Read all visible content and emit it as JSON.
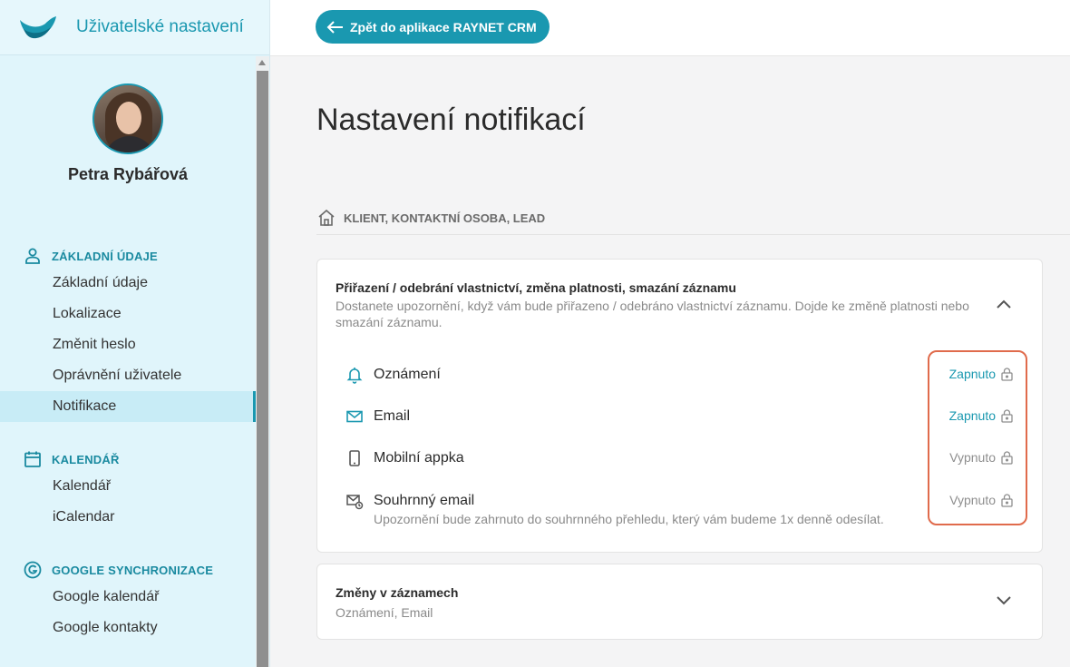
{
  "sidebar": {
    "title": "Uživatelské nastavení",
    "profile_name": "Petra Rybářová",
    "sections": [
      {
        "label": "ZÁKLADNÍ ÚDAJE",
        "icon": "person-icon",
        "items": [
          "Základní údaje",
          "Lokalizace",
          "Změnit heslo",
          "Oprávnění uživatele",
          "Notifikace"
        ]
      },
      {
        "label": "KALENDÁŘ",
        "icon": "calendar-icon",
        "items": [
          "Kalendář",
          "iCalendar"
        ]
      },
      {
        "label": "GOOGLE SYNCHRONIZACE",
        "icon": "google-icon",
        "items": [
          "Google kalendář",
          "Google kontakty"
        ]
      }
    ],
    "active_item": "Notifikace"
  },
  "topbar": {
    "back_label": "Zpět do aplikace RAYNET CRM"
  },
  "main": {
    "title": "Nastavení notifikací",
    "category": "KLIENT, KONTAKTNÍ OSOBA, LEAD",
    "cards": [
      {
        "title": "Přiřazení / odebrání vlastnictví, změna platnosti, smazání záznamu",
        "description": "Dostanete upozornění, když vám bude přiřazeno / odebráno vlastnictví záznamu. Dojde ke změně platnosti nebo smazání záznamu.",
        "expanded": true,
        "rows": [
          {
            "label": "Oznámení",
            "icon": "bell-icon",
            "status": "Zapnuto",
            "enabled": true
          },
          {
            "label": "Email",
            "icon": "mail-icon",
            "status": "Zapnuto",
            "enabled": true
          },
          {
            "label": "Mobilní appka",
            "icon": "phone-icon",
            "status": "Vypnuto",
            "enabled": false
          },
          {
            "label": "Souhrnný email",
            "icon": "mail-clock-icon",
            "status": "Vypnuto",
            "enabled": false,
            "sub": "Upozornění bude zahrnuto do souhrnného přehledu, který vám budeme 1x denně odesílat."
          }
        ]
      },
      {
        "title": "Změny v záznamech",
        "description": "Oznámení, Email",
        "expanded": false
      }
    ]
  },
  "colors": {
    "accent": "#1a98b0",
    "highlight": "#e06b4c",
    "sidebar_bg": "#e0f5fb"
  }
}
